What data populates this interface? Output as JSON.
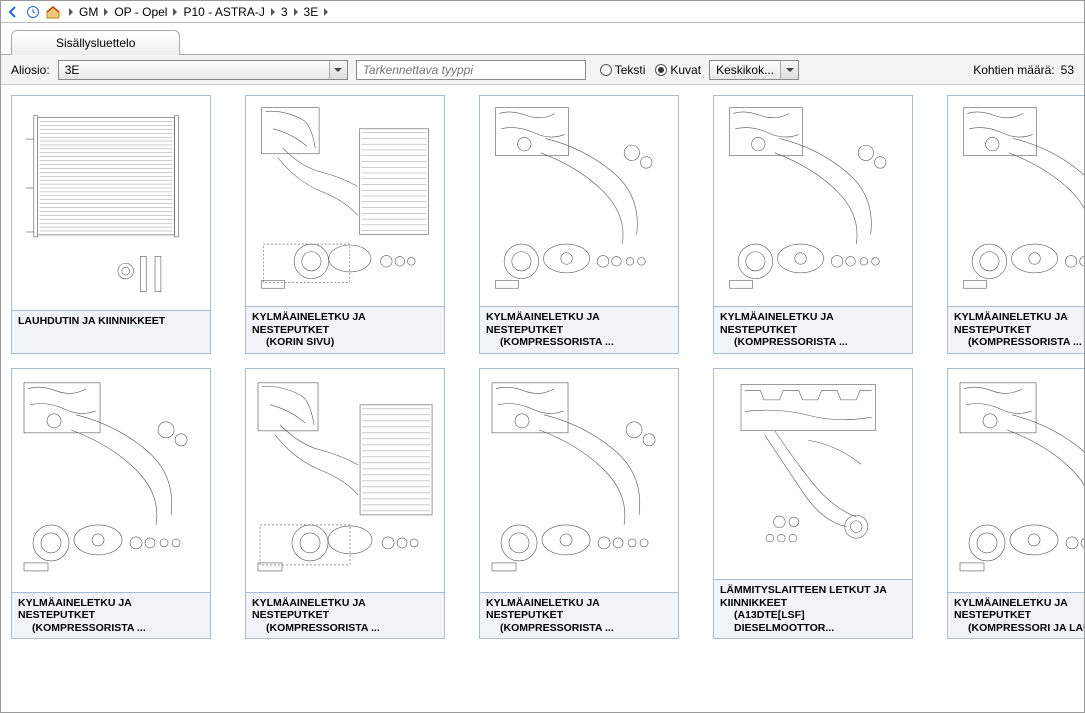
{
  "breadcrumb": [
    "GM",
    "OP - Opel",
    "P10 - ASTRA-J",
    "3",
    "3E"
  ],
  "tab_label": "Sisällysluettelo",
  "filter": {
    "aliosio_label": "Aliosio:",
    "aliosio_value": "3E",
    "type_placeholder": "Tarkennettava tyyppi",
    "radio_text": "Teksti",
    "radio_images": "Kuvat",
    "size_value": "Keskikok...",
    "count_label": "Kohtien määrä:",
    "count_value": "53"
  },
  "cards": [
    {
      "title": "LAUHDUTIN JA KIINNIKKEET",
      "sub": ""
    },
    {
      "title": "KYLMÄAINELETKU JA NESTEPUTKET",
      "sub": "(KORIN SIVU)"
    },
    {
      "title": "KYLMÄAINELETKU JA NESTEPUTKET",
      "sub": "(KOMPRESSORISTA ..."
    },
    {
      "title": "KYLMÄAINELETKU JA NESTEPUTKET",
      "sub": "(KOMPRESSORISTA ..."
    },
    {
      "title": "KYLMÄAINELETKU JA NESTEPUTKET",
      "sub": "(KOMPRESSORISTA ..."
    },
    {
      "title": "KYLMÄAINELETKU JA NESTEPUTKET",
      "sub": "(KOMPRESSORISTA ..."
    },
    {
      "title": "KYLMÄAINELETKU JA NESTEPUTKET",
      "sub": "(KOMPRESSORISTA ..."
    },
    {
      "title": "KYLMÄAINELETKU JA NESTEPUTKET",
      "sub": "(KOMPRESSORISTA ..."
    },
    {
      "title": "LÄMMITYSLAITTEEN LETKUT JA KIINNIKKEET",
      "sub": "(A13DTE[LSF] DIESELMOOTTOR..."
    },
    {
      "title": "KYLMÄAINELETKU JA NESTEPUTKET",
      "sub": "(KOMPRESSORI JA LAUH"
    }
  ]
}
